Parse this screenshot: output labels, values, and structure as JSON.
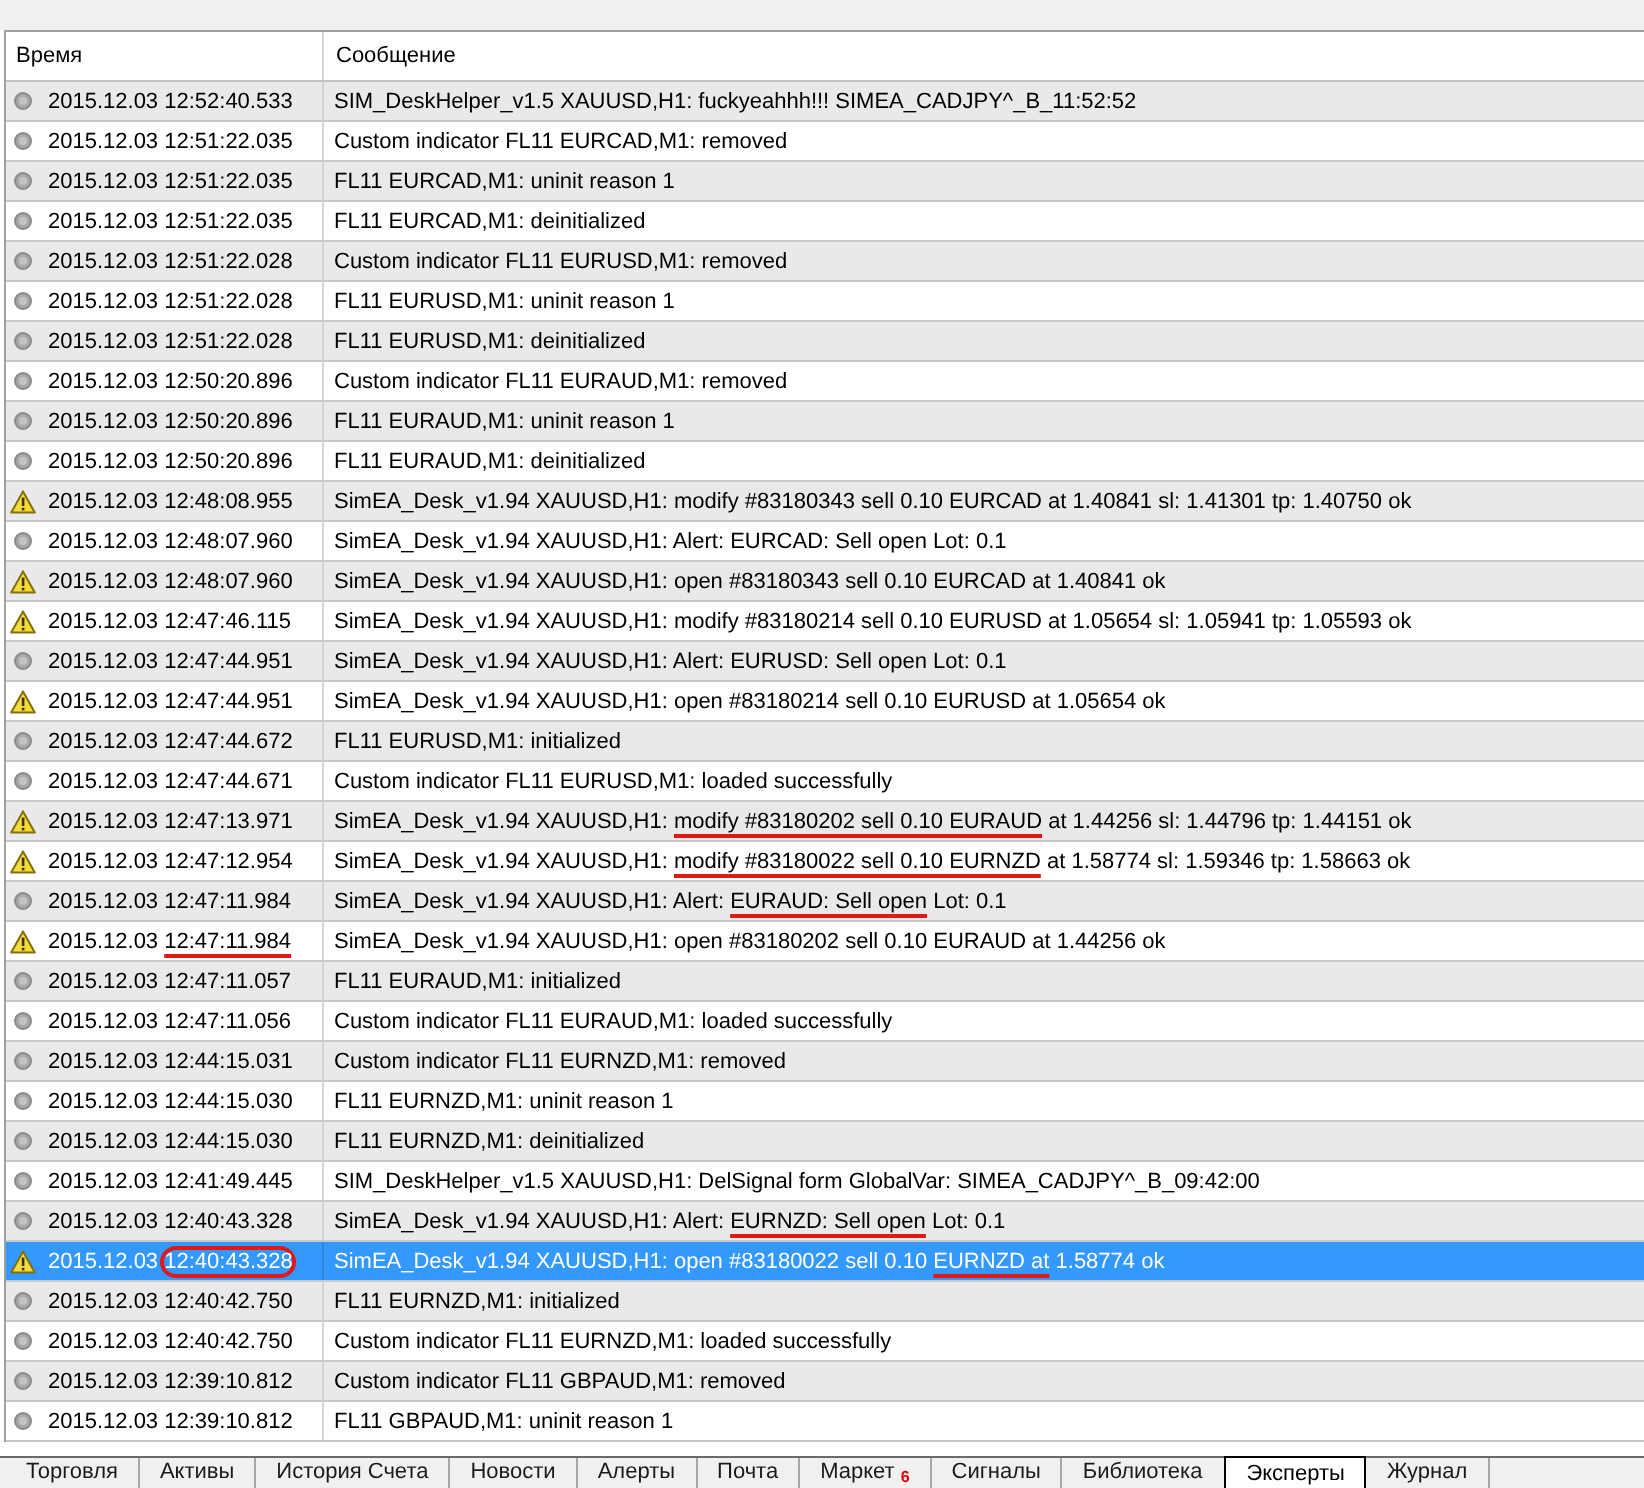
{
  "table": {
    "columns": [
      "Время",
      "Сообщение"
    ],
    "rows": [
      {
        "kind": "info",
        "selected": false,
        "time": "2015.12.03 12:52:40.533",
        "message": "SIM_DeskHelper_v1.5 XAUUSD,H1: fuckyeahhh!!! SIMEA_CADJPY^_B_11:52:52"
      },
      {
        "kind": "info",
        "selected": false,
        "time": "2015.12.03 12:51:22.035",
        "message": "Custom indicator FL11 EURCAD,M1: removed"
      },
      {
        "kind": "info",
        "selected": false,
        "time": "2015.12.03 12:51:22.035",
        "message": "FL11 EURCAD,M1: uninit reason 1"
      },
      {
        "kind": "info",
        "selected": false,
        "time": "2015.12.03 12:51:22.035",
        "message": "FL11 EURCAD,M1: deinitialized"
      },
      {
        "kind": "info",
        "selected": false,
        "time": "2015.12.03 12:51:22.028",
        "message": "Custom indicator FL11 EURUSD,M1: removed"
      },
      {
        "kind": "info",
        "selected": false,
        "time": "2015.12.03 12:51:22.028",
        "message": "FL11 EURUSD,M1: uninit reason 1"
      },
      {
        "kind": "info",
        "selected": false,
        "time": "2015.12.03 12:51:22.028",
        "message": "FL11 EURUSD,M1: deinitialized"
      },
      {
        "kind": "info",
        "selected": false,
        "time": "2015.12.03 12:50:20.896",
        "message": "Custom indicator FL11 EURAUD,M1: removed"
      },
      {
        "kind": "info",
        "selected": false,
        "time": "2015.12.03 12:50:20.896",
        "message": "FL11 EURAUD,M1: uninit reason 1"
      },
      {
        "kind": "info",
        "selected": false,
        "time": "2015.12.03 12:50:20.896",
        "message": "FL11 EURAUD,M1: deinitialized"
      },
      {
        "kind": "warning",
        "selected": false,
        "time": "2015.12.03 12:48:08.955",
        "message": "SimEA_Desk_v1.94 XAUUSD,H1: modify #83180343 sell 0.10 EURCAD at 1.40841 sl: 1.41301 tp: 1.40750 ok"
      },
      {
        "kind": "info",
        "selected": false,
        "time": "2015.12.03 12:48:07.960",
        "message": "SimEA_Desk_v1.94 XAUUSD,H1: Alert: EURCAD: Sell open Lot: 0.1"
      },
      {
        "kind": "warning",
        "selected": false,
        "time": "2015.12.03 12:48:07.960",
        "message": "SimEA_Desk_v1.94 XAUUSD,H1: open #83180343 sell 0.10 EURCAD at 1.40841 ok"
      },
      {
        "kind": "warning",
        "selected": false,
        "time": "2015.12.03 12:47:46.115",
        "message": "SimEA_Desk_v1.94 XAUUSD,H1: modify #83180214 sell 0.10 EURUSD at 1.05654 sl: 1.05941 tp: 1.05593 ok"
      },
      {
        "kind": "info",
        "selected": false,
        "time": "2015.12.03 12:47:44.951",
        "message": "SimEA_Desk_v1.94 XAUUSD,H1: Alert: EURUSD: Sell open Lot: 0.1"
      },
      {
        "kind": "warning",
        "selected": false,
        "time": "2015.12.03 12:47:44.951",
        "message": "SimEA_Desk_v1.94 XAUUSD,H1: open #83180214 sell 0.10 EURUSD at 1.05654 ok"
      },
      {
        "kind": "info",
        "selected": false,
        "time": "2015.12.03 12:47:44.672",
        "message": "FL11 EURUSD,M1: initialized"
      },
      {
        "kind": "info",
        "selected": false,
        "time": "2015.12.03 12:47:44.671",
        "message": "Custom indicator FL11 EURUSD,M1: loaded successfully"
      },
      {
        "kind": "warning",
        "selected": false,
        "time": "2015.12.03 12:47:13.971",
        "message": [
          {
            "kind": "plain",
            "text": "SimEA_Desk_v1.94 XAUUSD,H1:"
          },
          {
            "kind": "underlined",
            "text": "modify #83180202 sell 0.10 EURAUD"
          },
          {
            "kind": "plain",
            "text": "at 1.44256 sl: 1.44796 tp: 1.44151 ok"
          }
        ]
      },
      {
        "kind": "warning",
        "selected": false,
        "time": "2015.12.03 12:47:12.954",
        "message": [
          {
            "kind": "plain",
            "text": "SimEA_Desk_v1.94 XAUUSD,H1:"
          },
          {
            "kind": "underlined",
            "text": "modify #83180022 sell 0.10 EURNZD"
          },
          {
            "kind": "plain",
            "text": "at 1.58774 sl: 1.59346 tp: 1.58663 ok"
          }
        ]
      },
      {
        "kind": "info",
        "selected": false,
        "time": "2015.12.03 12:47:11.984",
        "message": [
          {
            "kind": "plain",
            "text": "SimEA_Desk_v1.94 XAUUSD,H1: Alert:"
          },
          {
            "kind": "underlined",
            "text": "EURAUD: Sell open"
          },
          {
            "kind": "plain",
            "text": "Lot: 0.1"
          }
        ]
      },
      {
        "kind": "warning",
        "selected": false,
        "time": [
          {
            "kind": "plain",
            "text": "2015.12.03"
          },
          {
            "kind": "underlined",
            "text": "12:47:11.984"
          }
        ],
        "message": "SimEA_Desk_v1.94 XAUUSD,H1: open #83180202 sell 0.10 EURAUD at 1.44256 ok"
      },
      {
        "kind": "info",
        "selected": false,
        "time": "2015.12.03 12:47:11.057",
        "message": "FL11 EURAUD,M1: initialized"
      },
      {
        "kind": "info",
        "selected": false,
        "time": "2015.12.03 12:47:11.056",
        "message": "Custom indicator FL11 EURAUD,M1: loaded successfully"
      },
      {
        "kind": "info",
        "selected": false,
        "time": "2015.12.03 12:44:15.031",
        "message": "Custom indicator FL11 EURNZD,M1: removed"
      },
      {
        "kind": "info",
        "selected": false,
        "time": "2015.12.03 12:44:15.030",
        "message": "FL11 EURNZD,M1: uninit reason 1"
      },
      {
        "kind": "info",
        "selected": false,
        "time": "2015.12.03 12:44:15.030",
        "message": "FL11 EURNZD,M1: deinitialized"
      },
      {
        "kind": "info",
        "selected": false,
        "time": "2015.12.03 12:41:49.445",
        "message": "SIM_DeskHelper_v1.5 XAUUSD,H1: DelSignal form GlobalVar: SIMEA_CADJPY^_B_09:42:00"
      },
      {
        "kind": "info",
        "selected": false,
        "time": "2015.12.03 12:40:43.328",
        "message": [
          {
            "kind": "plain",
            "text": "SimEA_Desk_v1.94 XAUUSD,H1: Alert:"
          },
          {
            "kind": "underlined",
            "text": "EURNZD: Sell open"
          },
          {
            "kind": "plain",
            "text": "Lot: 0.1"
          }
        ]
      },
      {
        "kind": "warning",
        "selected": true,
        "time": [
          {
            "kind": "plain",
            "text": "2015.12.03"
          },
          {
            "kind": "circled",
            "text": "12:40:43.328"
          }
        ],
        "message": [
          {
            "kind": "plain",
            "text": "SimEA_Desk_v1.94 XAUUSD,H1: open #83180022 sell 0.10"
          },
          {
            "kind": "underlined",
            "text": "EURNZD at"
          },
          {
            "kind": "plain",
            "text": "1.58774 ok"
          }
        ]
      },
      {
        "kind": "info",
        "selected": false,
        "time": "2015.12.03 12:40:42.750",
        "message": "FL11 EURNZD,M1: initialized"
      },
      {
        "kind": "info",
        "selected": false,
        "time": "2015.12.03 12:40:42.750",
        "message": "Custom indicator FL11 EURNZD,M1: loaded successfully"
      },
      {
        "kind": "info",
        "selected": false,
        "time": "2015.12.03 12:39:10.812",
        "message": "Custom indicator FL11 GBPAUD,M1: removed"
      },
      {
        "kind": "info",
        "selected": false,
        "time": "2015.12.03 12:39:10.812",
        "message": "FL11 GBPAUD,M1: uninit reason 1"
      }
    ]
  },
  "tabs": [
    {
      "label": "Торговля",
      "selected": false
    },
    {
      "label": "Активы",
      "selected": false
    },
    {
      "label": "История Счета",
      "selected": false
    },
    {
      "label": "Новости",
      "selected": false
    },
    {
      "label": "Алерты",
      "selected": false
    },
    {
      "label": "Почта",
      "selected": false
    },
    {
      "label": "Маркет",
      "selected": false,
      "badge": "6"
    },
    {
      "label": "Сигналы",
      "selected": false
    },
    {
      "label": "Библиотека",
      "selected": false
    },
    {
      "label": "Эксперты",
      "selected": true
    },
    {
      "label": "Журнал",
      "selected": false
    }
  ]
}
